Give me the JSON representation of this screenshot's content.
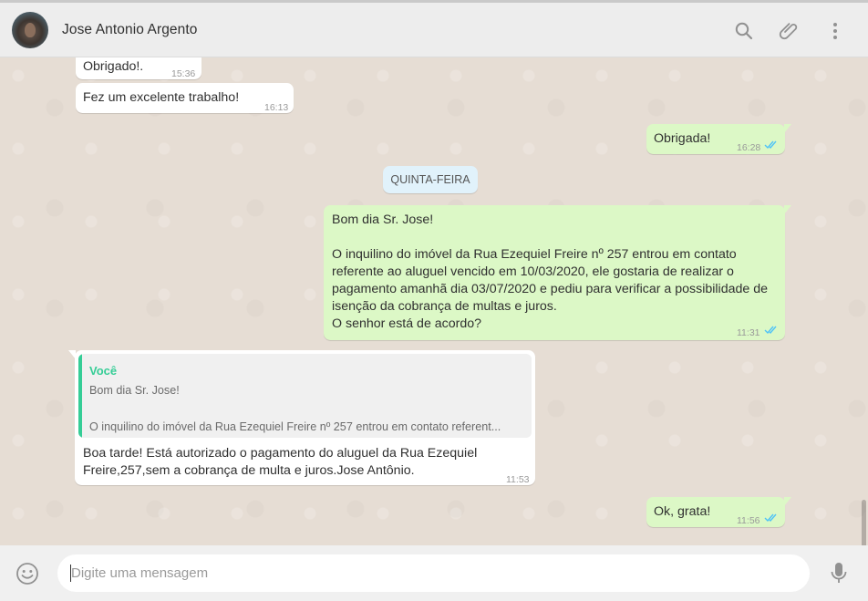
{
  "header": {
    "contact_name": "Jose Antonio Argento"
  },
  "messages": {
    "m1": {
      "text": "Obrigado!.",
      "time": "15:36"
    },
    "m2": {
      "text": "Fez um excelente trabalho!",
      "time": "16:13"
    },
    "m3": {
      "text": "Obrigada!",
      "time": "16:28"
    },
    "day_separator": "QUINTA-FEIRA",
    "m4": {
      "lines": [
        "Bom dia Sr. Jose!",
        "O inquilino do imóvel da Rua Ezequiel Freire nº 257 entrou em contato",
        "referente ao aluguel vencido em 10/03/2020, ele gostaria de realizar o",
        "pagamento amanhã dia 03/07/2020 e pediu para verificar a possibilidade de",
        "isenção da cobrança de multas e juros.",
        "O senhor está de acordo?"
      ],
      "time": "11:31"
    },
    "m5": {
      "quote_author": "Você",
      "quote_line1": "Bom dia Sr. Jose!",
      "quote_line2": "O inquilino do imóvel da Rua Ezequiel Freire nº 257 entrou em contato referent...",
      "lines": [
        "Boa tarde! Está autorizado o pagamento do aluguel da Rua Ezequiel",
        "Freire,257,sem a cobrança de multa e juros.Jose Antônio."
      ],
      "time": "11:53"
    },
    "m6": {
      "text": "Ok, grata!",
      "time": "11:56"
    }
  },
  "composer": {
    "placeholder": "Digite uma mensagem"
  },
  "colors": {
    "outgoing_bubble": "#dcf8c6",
    "incoming_bubble": "#ffffff",
    "read_ticks": "#4fc3f7",
    "quote_accent": "#35cd96",
    "day_chip": "#e1f2fb"
  },
  "icons": [
    "search-icon",
    "attach-icon",
    "menu-icon",
    "emoji-icon",
    "microphone-icon",
    "read-ticks-icon"
  ]
}
